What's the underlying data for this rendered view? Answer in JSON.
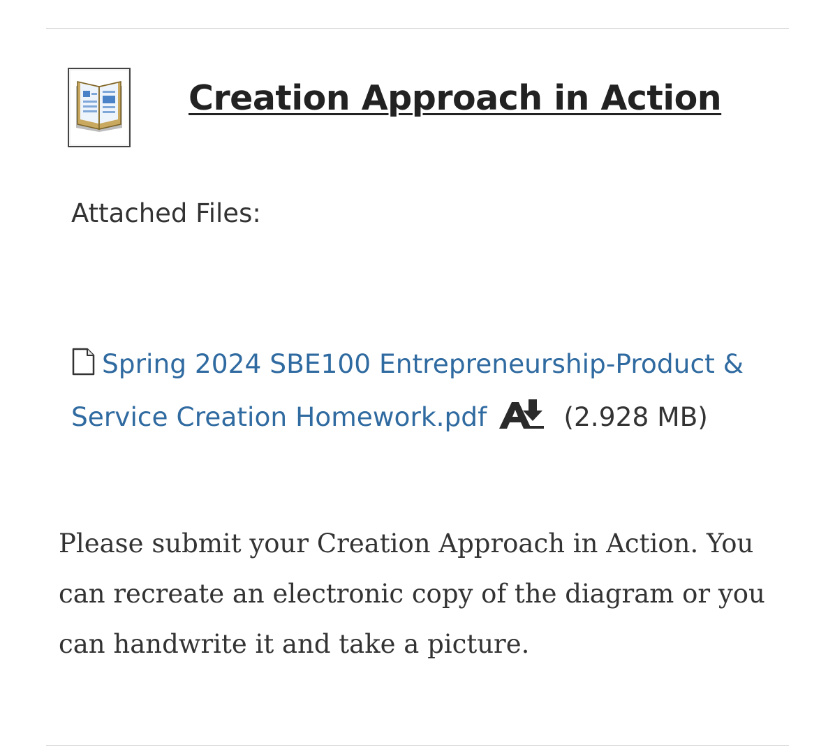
{
  "item": {
    "title": "Creation Approach in Action",
    "icon": "content-item-icon"
  },
  "attachments": {
    "label": "Attached Files:",
    "files": [
      {
        "icon": "document-icon",
        "name": "Spring 2024 SBE100 Entrepreneurship-Product & Service Creation Homework.pdf",
        "action_icon": "read-aloud-download-icon",
        "size": "(2.928 MB)"
      }
    ]
  },
  "description": "Please submit your Creation Approach in Action. You can recreate an electronic copy of the diagram or you can handwrite it and take a picture.",
  "colors": {
    "link": "#2f6aa0",
    "text": "#333333",
    "title": "#222222",
    "divider": "#d0d0d0"
  }
}
